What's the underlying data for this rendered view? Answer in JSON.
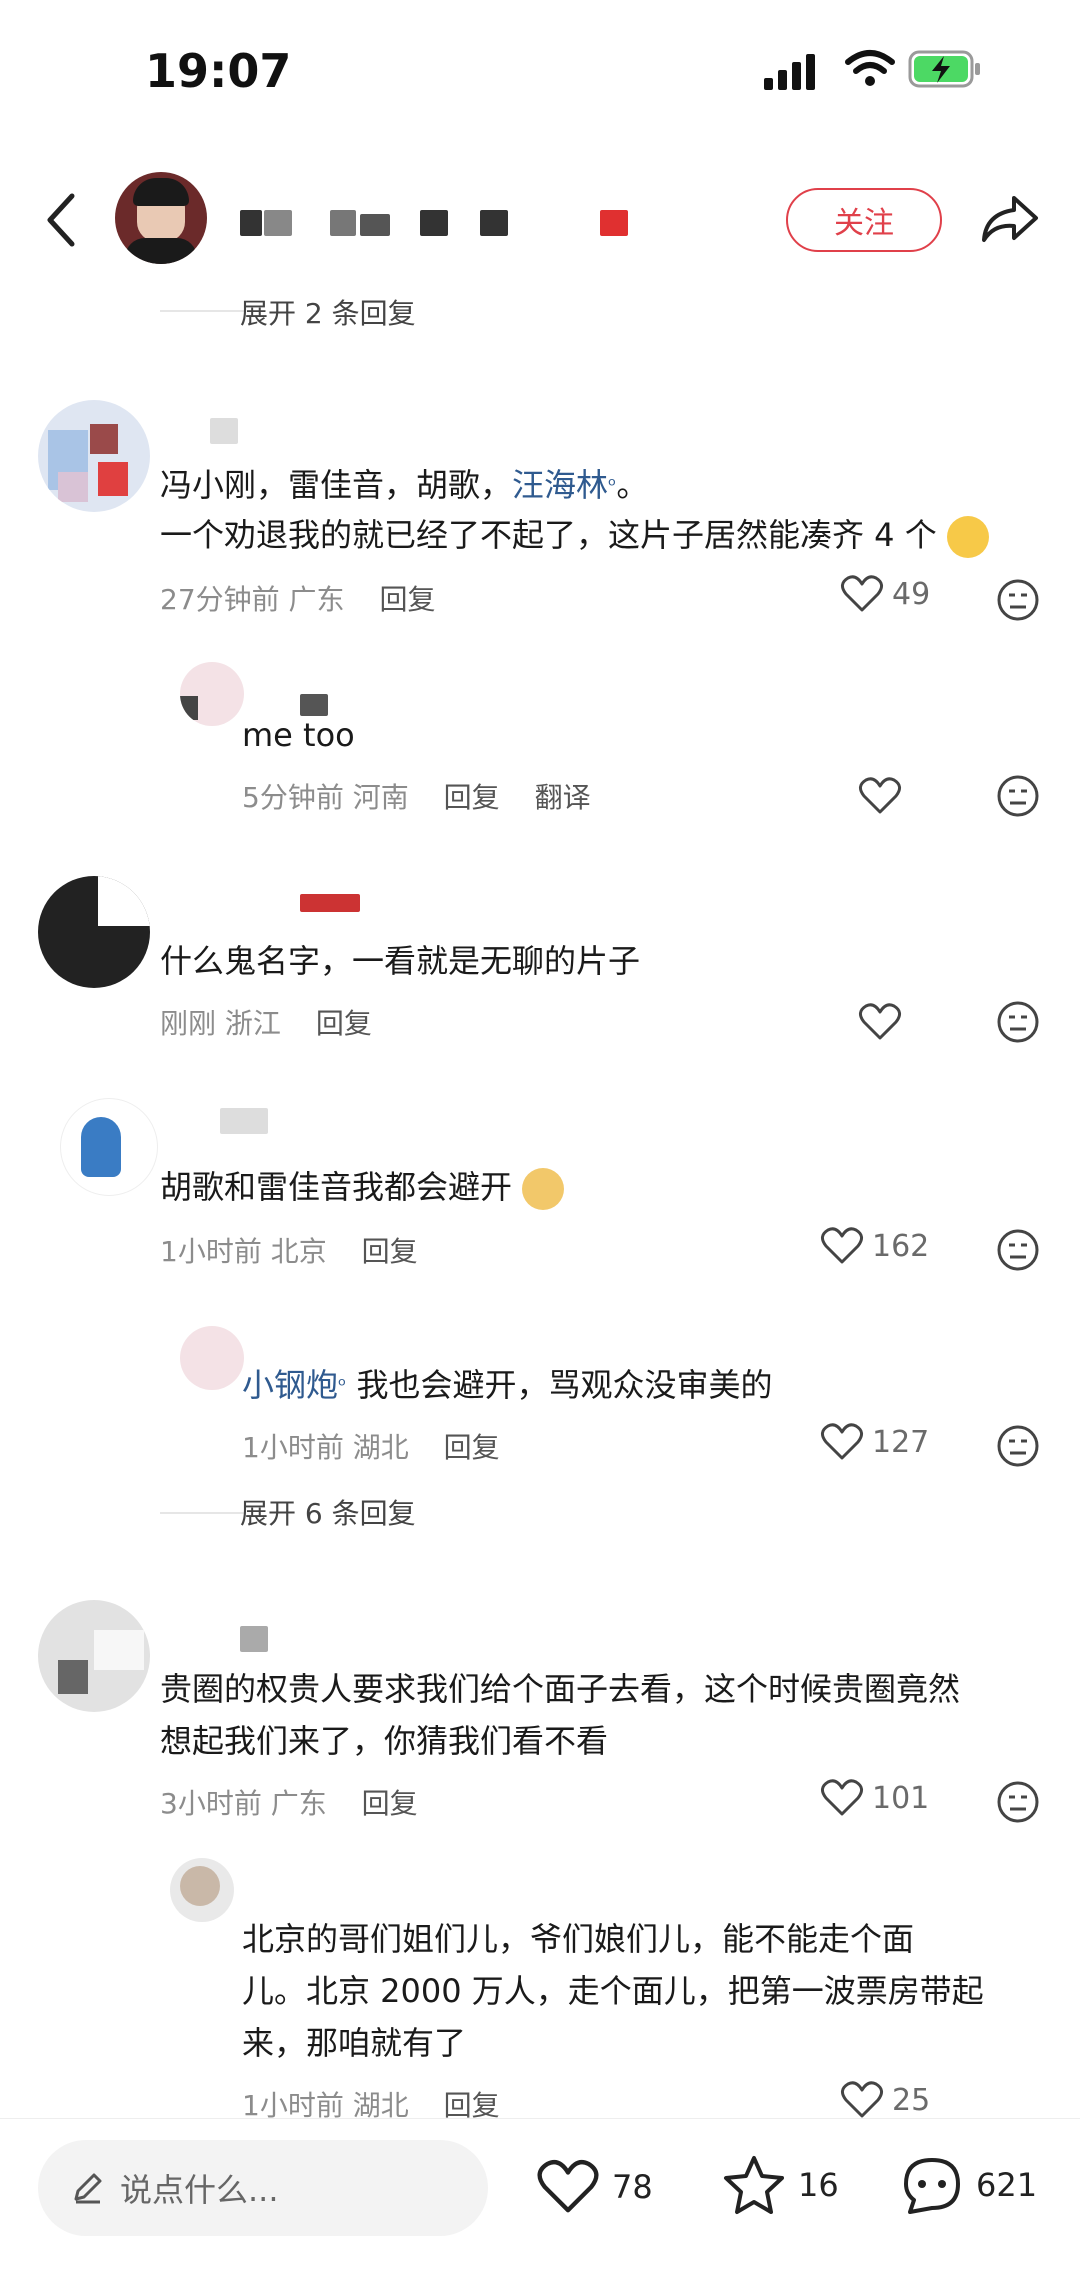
{
  "status_bar": {
    "time": "19:07"
  },
  "header": {
    "follow_label": "关注"
  },
  "expand_top": "展开 2 条回复",
  "comments": [
    {
      "text_parts": [
        "冯小刚，雷佳音，胡歌，",
        "汪海林",
        "。"
      ],
      "text2": "一个劝退我的就已经了不起了，这片子居然能凑齐 4 个",
      "time": "27分钟前",
      "location": "广东",
      "reply_label": "回复",
      "likes": "49"
    },
    {
      "text": "me too",
      "time": "5分钟前",
      "location": "河南",
      "reply_label": "回复",
      "translate_label": "翻译",
      "likes": ""
    },
    {
      "text": "什么鬼名字，一看就是无聊的片子",
      "time": "刚刚",
      "location": "浙江",
      "reply_label": "回复",
      "likes": ""
    },
    {
      "text": "胡歌和雷佳音我都会避开",
      "time": "1小时前",
      "location": "北京",
      "reply_label": "回复",
      "likes": "162"
    },
    {
      "reply_to": "小钢炮",
      "text": "我也会避开，骂观众没审美的",
      "time": "1小时前",
      "location": "湖北",
      "reply_label": "回复",
      "likes": "127"
    },
    {
      "line1": "贵圈的权贵人要求我们给个面子去看，这个时候贵圈竟然",
      "line2": "想起我们来了，你猜我们看不看",
      "time": "3小时前",
      "location": "广东",
      "reply_label": "回复",
      "likes": "101"
    },
    {
      "line1": "北京的哥们姐们儿，爷们娘们儿，能不能走个面",
      "line2": "儿。北京 2000 万人，走个面儿，把第一波票房带起",
      "line3": "来，那咱就有了",
      "time": "1小时前",
      "location": "湖北",
      "reply_label": "回复",
      "likes": "25"
    }
  ],
  "expand_mid": "展开 6 条回复",
  "bottom_bar": {
    "input_placeholder": "说点什么...",
    "like_count": "78",
    "star_count": "16",
    "comment_count": "621"
  },
  "colors": {
    "accent": "#e0404a",
    "mention": "#2f5a8f",
    "meta": "#8c8c8c"
  }
}
